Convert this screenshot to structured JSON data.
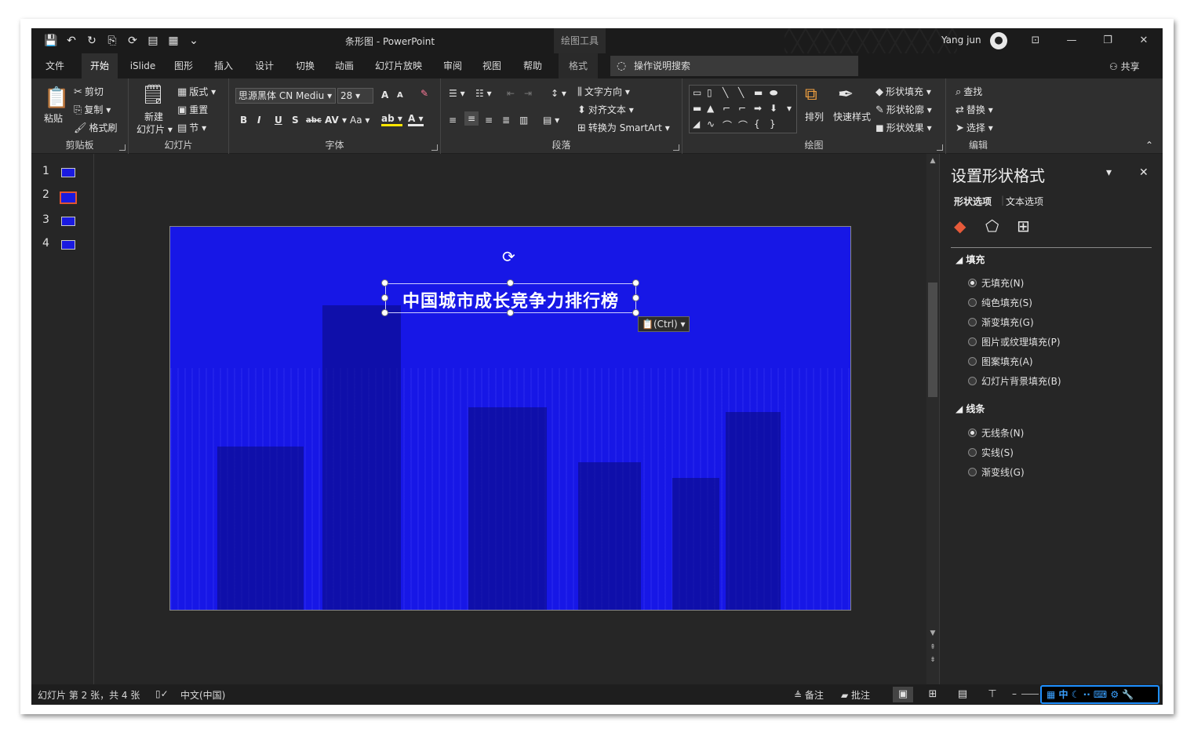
{
  "window": {
    "title": "条形图  -  PowerPoint",
    "tool_context": "绘图工具",
    "user": "Yang jun",
    "controls": [
      "⊡",
      "—",
      "❐",
      "✕"
    ]
  },
  "quick_access": [
    "💾",
    "↶",
    "↻",
    "⎘",
    "⟳",
    "▤",
    "▦",
    "⌄"
  ],
  "tabs": [
    {
      "label": "文件"
    },
    {
      "label": "开始"
    },
    {
      "label": "iSlide"
    },
    {
      "label": "图形"
    },
    {
      "label": "插入"
    },
    {
      "label": "设计"
    },
    {
      "label": "切换"
    },
    {
      "label": "动画"
    },
    {
      "label": "幻灯片放映"
    },
    {
      "label": "审阅"
    },
    {
      "label": "视图"
    },
    {
      "label": "帮助"
    },
    {
      "label": "格式"
    }
  ],
  "tell_me": "操作说明搜索",
  "share": "共享",
  "ribbon": {
    "clipboard": {
      "label": "剪贴板",
      "paste": "粘贴",
      "cut": "剪切",
      "copy": "复制",
      "painter": "格式刷"
    },
    "slides": {
      "label": "幻灯片",
      "new": "新建",
      "new2": "幻灯片",
      "layout": "版式",
      "reset": "重置",
      "section": "节"
    },
    "font": {
      "label": "字体",
      "name": "思源黑体 CN Mediu",
      "size": "28",
      "bold": "B",
      "italic": "I",
      "underline": "U",
      "shadow": "S",
      "strike": "abc",
      "spacing": "AV",
      "case": "Aa",
      "grow": "A",
      "shrink": "A"
    },
    "paragraph": {
      "label": "段落",
      "direction": "文字方向",
      "align": "对齐文本",
      "smartart": "转换为 SmartArt"
    },
    "drawing": {
      "label": "绘图",
      "arrange": "排列",
      "quick": "快速样式",
      "fill": "形状填充",
      "outline": "形状轮廓",
      "effect": "形状效果"
    },
    "editing": {
      "label": "编辑",
      "find": "查找",
      "replace": "替换",
      "select": "选择"
    }
  },
  "thumbnails": [
    "1",
    "2",
    "3",
    "4"
  ],
  "selected_slide": 2,
  "slide": {
    "title": "中国城市成长竞争力排行榜",
    "paste_option": "(Ctrl)",
    "background": "#1717e6"
  },
  "pane": {
    "title": "设置形状格式",
    "tab_shape": "形状选项",
    "tab_text": "文本选项",
    "fill_section": "填充",
    "fill_options": [
      {
        "label": "无填充(N)",
        "checked": true
      },
      {
        "label": "纯色填充(S)",
        "checked": false
      },
      {
        "label": "渐变填充(G)",
        "checked": false
      },
      {
        "label": "图片或纹理填充(P)",
        "checked": false
      },
      {
        "label": "图案填充(A)",
        "checked": false
      },
      {
        "label": "幻灯片背景填充(B)",
        "checked": false
      }
    ],
    "line_section": "线条",
    "line_options": [
      {
        "label": "无线条(N)",
        "checked": true
      },
      {
        "label": "实线(S)",
        "checked": false
      },
      {
        "label": "渐变线(G)",
        "checked": false
      }
    ]
  },
  "status": {
    "slide_info": "幻灯片 第 2 张，共 4 张",
    "language": "中文(中国)",
    "notes": "备注",
    "comments": "批注",
    "ime": "中 ☾ ·· ⌨ ⚙ 🔧"
  }
}
